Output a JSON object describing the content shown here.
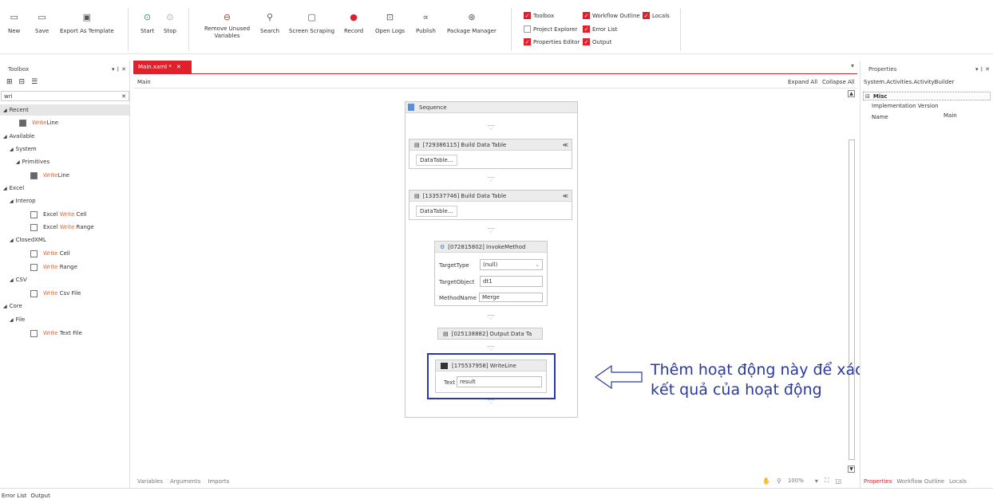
{
  "ribbon": {
    "new": "New",
    "save": "Save",
    "export_template": "Export As Template",
    "start": "Start",
    "stop": "Stop",
    "remove_unused_1": "Remove Unused",
    "remove_unused_2": "Variables",
    "search": "Search",
    "screen_scraping": "Screen Scraping",
    "record": "Record",
    "open_logs": "Open Logs",
    "publish": "Publish",
    "package_manager": "Package Manager",
    "checks": {
      "toolbox": "Toolbox",
      "project_explorer": "Project Explorer",
      "properties_editor": "Properties Editor",
      "workflow_outline": "Workflow Outline",
      "error_list": "Error List",
      "output": "Output",
      "locals": "Locals"
    }
  },
  "toolbox": {
    "title": "Toolbox",
    "pin": "▾ ᛒ ✕",
    "search_value": "wri",
    "clear": "✕",
    "recent": "Recent",
    "available": "Available",
    "system": "System",
    "primitives": "Primitives",
    "excel": "Excel",
    "interop": "Interop",
    "closedxml": "ClosedXML",
    "csv": "CSV",
    "core": "Core",
    "file": "File",
    "items": {
      "writeline_recent_hl": "Write",
      "writeline_recent_rest": "Line",
      "writeline_hl": "Write",
      "writeline_rest": "Line",
      "excel_write_cell_pre": "Excel ",
      "excel_write_cell_hl": "Write",
      "excel_write_cell_post": " Cell",
      "excel_write_range_pre": "Excel ",
      "excel_write_range_hl": "Write",
      "excel_write_range_post": " Range",
      "write_cell_hl": "Write",
      "write_cell_post": " Cell",
      "write_range_hl": "Write",
      "write_range_post": " Range",
      "write_csv_hl": "Write",
      "write_csv_post": " Csv File",
      "write_text_hl": "Write",
      "write_text_post": " Text File"
    }
  },
  "designer": {
    "tab": "Main.xaml *",
    "tab_close": "✕",
    "breadcrumb": "Main",
    "expand_all": "Expand All",
    "collapse_all": "Collapse All",
    "sequence": "Sequence",
    "build1": "[729386115] Build Data Table",
    "build2": "[133537746] Build Data Table",
    "datatable_btn": "DataTable...",
    "invoke": "[072815802] InvokeMethod",
    "target_type_label": "TargetType",
    "target_type_value": "(null)",
    "target_object_label": "TargetObject",
    "target_object_value": "dt1",
    "method_name_label": "MethodName",
    "method_name_value": "Merge",
    "output_dt": "[025138882] Output Data Ta",
    "writeline": "[175537958] WriteLine",
    "text_label": "Text",
    "text_value": "result",
    "annotation_line1": "Thêm hoạt động này để xác nhận",
    "annotation_line2": "kết quả của hoạt động",
    "footer_variables": "Variables",
    "footer_arguments": "Arguments",
    "footer_imports": "Imports",
    "zoom": "100%"
  },
  "properties": {
    "title": "Properties",
    "pin": "▾ ᛒ ✕",
    "type": "System.Activities.ActivityBuilder",
    "misc": "Misc",
    "impl_version": "Implementation Version",
    "name_label": "Name",
    "name_value": "Main",
    "tabs": [
      "Properties",
      "Workflow Outline",
      "Locals"
    ]
  },
  "bottom": {
    "error_list": "Error List",
    "output": "Output"
  },
  "colors": {
    "accent": "#e0202a",
    "highlight": "#e8612c",
    "annotation": "#2b3a9e"
  }
}
